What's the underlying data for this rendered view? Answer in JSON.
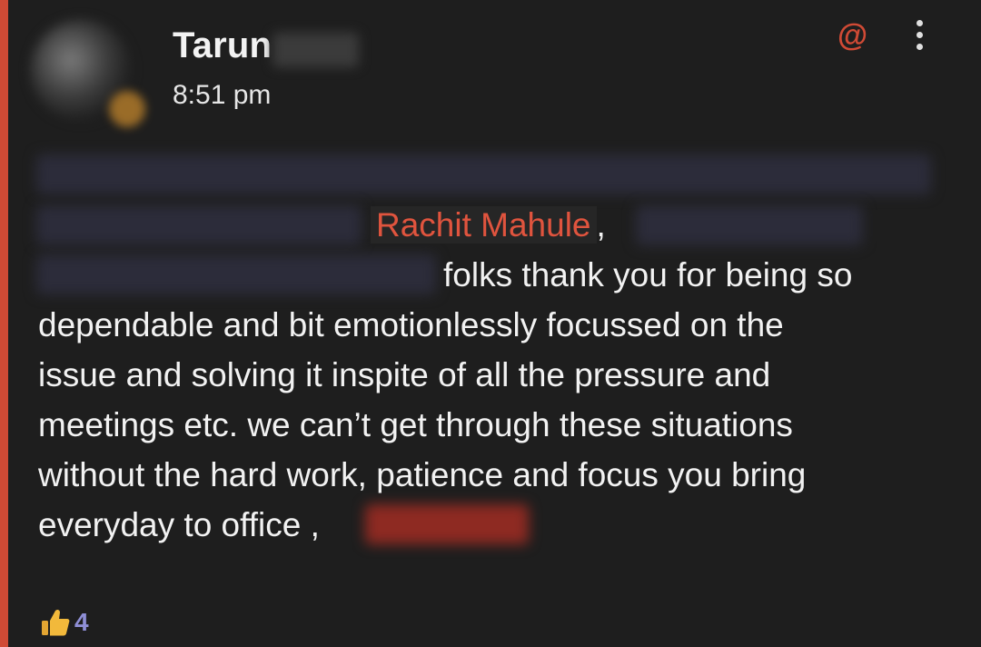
{
  "message": {
    "author": "Tarun",
    "time": "8:51 pm",
    "mention_name": "Rachit Mahule",
    "mention_suffix": ",",
    "line3_text": "folks thank you for being so",
    "line4_text": "dependable and bit emotionlessly focussed on the",
    "line5_text": "issue and solving it inspite of all the pressure and",
    "line6_text": "meetings etc. we can’t get through these situations",
    "line7_text": "without the hard work, patience and focus you bring",
    "line8_text": "everyday to office ,"
  },
  "header_actions": {
    "mention_symbol": "@"
  },
  "reaction": {
    "icon": "thumbs-up-icon",
    "count": "4"
  },
  "colors": {
    "accent": "#d04a35",
    "mention": "#e0543e",
    "background": "#1e1e1e",
    "reaction_count": "#8f8fd6"
  }
}
